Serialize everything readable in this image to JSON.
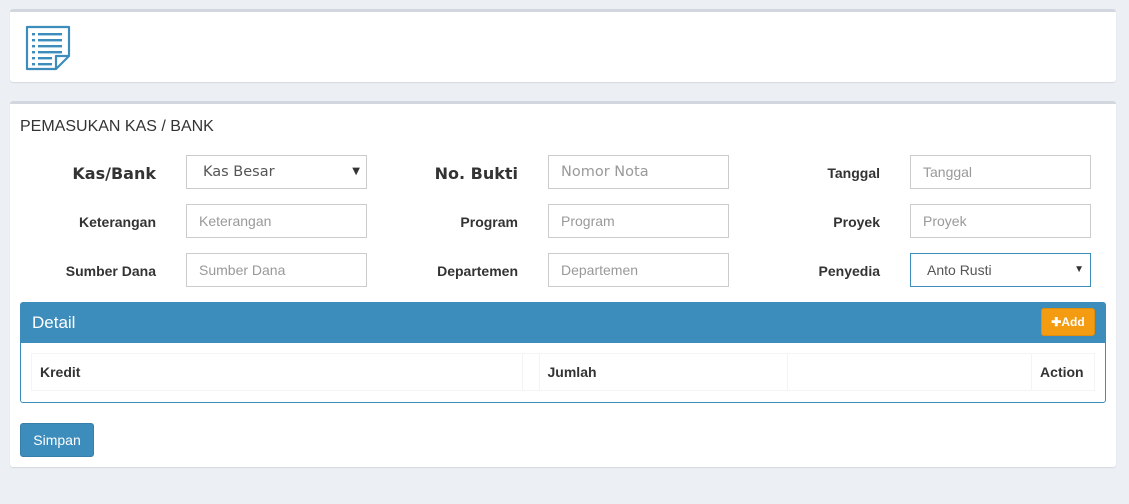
{
  "header": {
    "icon": "document-list-icon"
  },
  "form": {
    "title": "PEMASUKAN KAS / BANK",
    "kas_bank": {
      "label": "Kas/Bank",
      "value": "Kas Besar"
    },
    "no_bukti": {
      "label": "No. Bukti",
      "placeholder": "Nomor Nota"
    },
    "tanggal": {
      "label": "Tanggal",
      "placeholder": "Tanggal"
    },
    "keterangan": {
      "label": "Keterangan",
      "placeholder": "Keterangan"
    },
    "program": {
      "label": "Program",
      "placeholder": "Program"
    },
    "proyek": {
      "label": "Proyek",
      "placeholder": "Proyek"
    },
    "sumber_dana": {
      "label": "Sumber Dana",
      "placeholder": "Sumber Dana"
    },
    "departemen": {
      "label": "Departemen",
      "placeholder": "Departemen"
    },
    "penyedia": {
      "label": "Penyedia",
      "value": "Anto Rusti"
    }
  },
  "detail": {
    "title": "Detail",
    "add_label": "Add",
    "add_icon": "plus-icon",
    "columns": [
      "Kredit",
      "",
      "Jumlah",
      "",
      "Action"
    ]
  },
  "actions": {
    "save_label": "Simpan"
  },
  "colors": {
    "primary": "#3c8dbc",
    "warning": "#f39c12",
    "background": "#ecf0f5"
  }
}
